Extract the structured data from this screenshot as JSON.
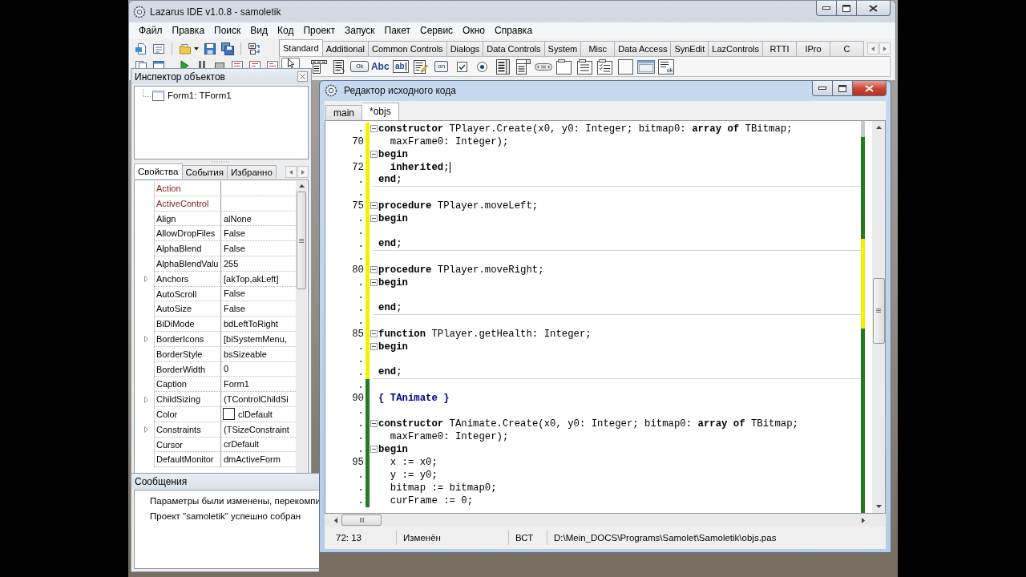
{
  "ide_window": {
    "title": "Lazarus IDE v1.0.8 - samoletik",
    "menu": [
      "Файл",
      "Правка",
      "Поиск",
      "Вид",
      "Код",
      "Проект",
      "Запуск",
      "Пакет",
      "Сервис",
      "Окно",
      "Справка"
    ],
    "palette_tabs": [
      {
        "label": "Standard",
        "selected": true
      },
      {
        "label": "Additional",
        "selected": false
      },
      {
        "label": "Common Controls",
        "selected": false
      },
      {
        "label": "Dialogs",
        "selected": false
      },
      {
        "label": "Data Controls",
        "selected": false
      },
      {
        "label": "System",
        "selected": false
      },
      {
        "label": "Misc",
        "selected": false
      },
      {
        "label": "Data Access",
        "selected": false
      },
      {
        "label": "SynEdit",
        "selected": false
      },
      {
        "label": "LazControls",
        "selected": false
      },
      {
        "label": "RTTI",
        "selected": false
      },
      {
        "label": "IPro",
        "selected": false
      },
      {
        "label": "C",
        "selected": false
      }
    ],
    "components": [
      {
        "kind": "pointer"
      },
      {
        "kind": "main-menu"
      },
      {
        "kind": "popup-menu"
      },
      {
        "kind": "button",
        "text": "Ok"
      },
      {
        "kind": "label",
        "text": "Abc"
      },
      {
        "kind": "edit",
        "text": "ab"
      },
      {
        "kind": "memo"
      },
      {
        "kind": "toggle",
        "text": "on"
      },
      {
        "kind": "checkbox"
      },
      {
        "kind": "radio"
      },
      {
        "kind": "list-box"
      },
      {
        "kind": "combo-box"
      },
      {
        "kind": "scroll-bar"
      },
      {
        "kind": "group-box"
      },
      {
        "kind": "radio-group"
      },
      {
        "kind": "check-group"
      },
      {
        "kind": "panel"
      },
      {
        "kind": "frame"
      },
      {
        "kind": "action-list",
        "text": "ok"
      }
    ]
  },
  "object_inspector": {
    "title": "Инспектор объектов",
    "tree": [
      {
        "label": "Form1: TForm1"
      }
    ],
    "tabs": [
      {
        "label": "Свойства",
        "selected": true
      },
      {
        "label": "События",
        "selected": false
      },
      {
        "label": "Избранно",
        "selected": false
      }
    ],
    "properties": [
      {
        "name": "Action",
        "kind": "reference",
        "expandable": false
      },
      {
        "name": "ActiveControl",
        "kind": "reference",
        "expandable": false
      },
      {
        "name": "Align",
        "value": "alNone",
        "kind": "plain",
        "expandable": false
      },
      {
        "name": "AllowDropFiles",
        "value": "False",
        "kind": "plain",
        "expandable": false
      },
      {
        "name": "AlphaBlend",
        "value": "False",
        "kind": "plain",
        "expandable": false
      },
      {
        "name": "AlphaBlendValu",
        "value": "255",
        "kind": "plain",
        "expandable": false
      },
      {
        "name": "Anchors",
        "value": "[akTop,akLeft]",
        "kind": "plain",
        "expandable": true
      },
      {
        "name": "AutoScroll",
        "value": "False",
        "kind": "plain",
        "expandable": false
      },
      {
        "name": "AutoSize",
        "value": "False",
        "kind": "plain",
        "expandable": false
      },
      {
        "name": "BiDiMode",
        "value": "bdLeftToRight",
        "kind": "plain",
        "expandable": false
      },
      {
        "name": "BorderIcons",
        "value": "[biSystemMenu,",
        "kind": "plain",
        "expandable": true
      },
      {
        "name": "BorderStyle",
        "value": "bsSizeable",
        "kind": "plain",
        "expandable": false
      },
      {
        "name": "BorderWidth",
        "value": "0",
        "kind": "plain",
        "expandable": false
      },
      {
        "name": "Caption",
        "value": "Form1",
        "kind": "plain",
        "expandable": false
      },
      {
        "name": "ChildSizing",
        "value": "(TControlChildSi",
        "kind": "plain",
        "expandable": true
      },
      {
        "name": "Color",
        "value": "clDefault",
        "kind": "plain",
        "expandable": false,
        "color": "#ffffff"
      },
      {
        "name": "Constraints",
        "value": "(TSizeConstraint",
        "kind": "plain",
        "expandable": true
      },
      {
        "name": "Cursor",
        "value": "crDefault",
        "kind": "plain",
        "expandable": false
      },
      {
        "name": "DefaultMonitor",
        "value": "dmActiveForm",
        "kind": "plain",
        "expandable": false
      }
    ]
  },
  "messages": {
    "title": "Сообщения",
    "lines": [
      "Параметры были изменены, перекомпи",
      "Проект \"samoletik\" успешно собран"
    ]
  },
  "source_editor": {
    "title": "Редактор исходного кода",
    "tabs": [
      {
        "label": "main",
        "selected": false
      },
      {
        "label": "*objs",
        "selected": true
      }
    ],
    "lines": [
      {
        "number": ".",
        "code": "**constructor** TPlayer.Create(x0, y0: Integer; bitmap0: **array of** TBitmap;",
        "kind": "code",
        "fold": true,
        "saved": false,
        "divider_below": false,
        "caret": false
      },
      {
        "number": "70",
        "code": "  maxFrame0: Integer);",
        "kind": "code",
        "fold": false,
        "saved": false,
        "divider_below": false,
        "caret": false
      },
      {
        "number": ".",
        "code": "**begin**",
        "kind": "code",
        "fold": true,
        "saved": false,
        "divider_below": false,
        "caret": false
      },
      {
        "number": "72",
        "code": "  **inherited**;",
        "kind": "code",
        "fold": false,
        "saved": false,
        "divider_below": false,
        "caret": true
      },
      {
        "number": ".",
        "code": "**end**;",
        "kind": "code",
        "fold": false,
        "saved": false,
        "divider_below": true,
        "caret": false
      },
      {
        "number": ".",
        "fold": false,
        "saved": false,
        "divider_below": false,
        "caret": false
      },
      {
        "number": "75",
        "code": "**procedure** TPlayer.moveLeft;",
        "kind": "code",
        "fold": true,
        "saved": false,
        "divider_below": false,
        "caret": false
      },
      {
        "number": ".",
        "code": "**begin**",
        "kind": "code",
        "fold": true,
        "saved": false,
        "divider_below": false,
        "caret": false
      },
      {
        "number": ".",
        "fold": false,
        "saved": false,
        "divider_below": false,
        "caret": false
      },
      {
        "number": ".",
        "code": "**end**;",
        "kind": "code",
        "fold": false,
        "saved": false,
        "divider_below": true,
        "caret": false
      },
      {
        "number": ".",
        "fold": false,
        "saved": false,
        "divider_below": false,
        "caret": false
      },
      {
        "number": "80",
        "code": "**procedure** TPlayer.moveRight;",
        "kind": "code",
        "fold": true,
        "saved": false,
        "divider_below": false,
        "caret": false
      },
      {
        "number": ".",
        "code": "**begin**",
        "kind": "code",
        "fold": true,
        "saved": false,
        "divider_below": false,
        "caret": false
      },
      {
        "number": ".",
        "fold": false,
        "saved": false,
        "divider_below": false,
        "caret": false
      },
      {
        "number": ".",
        "code": "**end**;",
        "kind": "code",
        "fold": false,
        "saved": false,
        "divider_below": true,
        "caret": false
      },
      {
        "number": ".",
        "fold": false,
        "saved": false,
        "divider_below": false,
        "caret": false
      },
      {
        "number": "85",
        "code": "**function** TPlayer.getHealth: Integer;",
        "kind": "code",
        "fold": true,
        "saved": false,
        "divider_below": false,
        "caret": false
      },
      {
        "number": ".",
        "code": "**begin**",
        "kind": "code",
        "fold": true,
        "saved": false,
        "divider_below": false,
        "caret": false
      },
      {
        "number": ".",
        "fold": false,
        "saved": false,
        "divider_below": false,
        "caret": false
      },
      {
        "number": ".",
        "code": "**end**;",
        "kind": "code",
        "fold": false,
        "saved": false,
        "divider_below": true,
        "caret": false
      },
      {
        "number": ".",
        "fold": false,
        "saved": true,
        "divider_below": false,
        "caret": false
      },
      {
        "number": "90",
        "code": "{ TAnimate }",
        "kind": "comment",
        "fold": false,
        "saved": true,
        "divider_below": false,
        "caret": false
      },
      {
        "number": ".",
        "fold": false,
        "saved": true,
        "divider_below": false,
        "caret": false
      },
      {
        "number": ".",
        "code": "**constructor** TAnimate.Create(x0, y0: Integer; bitmap0: **array of** TBitmap;",
        "kind": "code",
        "fold": true,
        "saved": true,
        "divider_below": false,
        "caret": false
      },
      {
        "number": ".",
        "code": "  maxFrame0: Integer);",
        "kind": "code",
        "fold": false,
        "saved": true,
        "divider_below": false,
        "caret": false
      },
      {
        "number": ".",
        "code": "**begin**",
        "kind": "code",
        "fold": true,
        "saved": true,
        "divider_below": false,
        "caret": false
      },
      {
        "number": "95",
        "code": "  x := x0;",
        "kind": "code",
        "fold": false,
        "saved": true,
        "divider_below": false,
        "caret": false
      },
      {
        "number": ".",
        "code": "  y := y0;",
        "kind": "code",
        "fold": false,
        "saved": true,
        "divider_below": false,
        "caret": false
      },
      {
        "number": ".",
        "code": "  bitmap := bitmap0;",
        "kind": "code",
        "fold": false,
        "saved": true,
        "divider_below": false,
        "caret": false
      },
      {
        "number": ".",
        "code": "  curFrame := 0;",
        "kind": "code",
        "fold": false,
        "saved": true,
        "divider_below": false,
        "caret": false
      }
    ],
    "status_bar": {
      "position": "72: 13",
      "modified": "Изменён",
      "insert_mode": "ВСТ",
      "file_path": "D:\\Mein_DOCS\\Programs\\Samolet\\Samoletik\\objs.pas"
    }
  }
}
